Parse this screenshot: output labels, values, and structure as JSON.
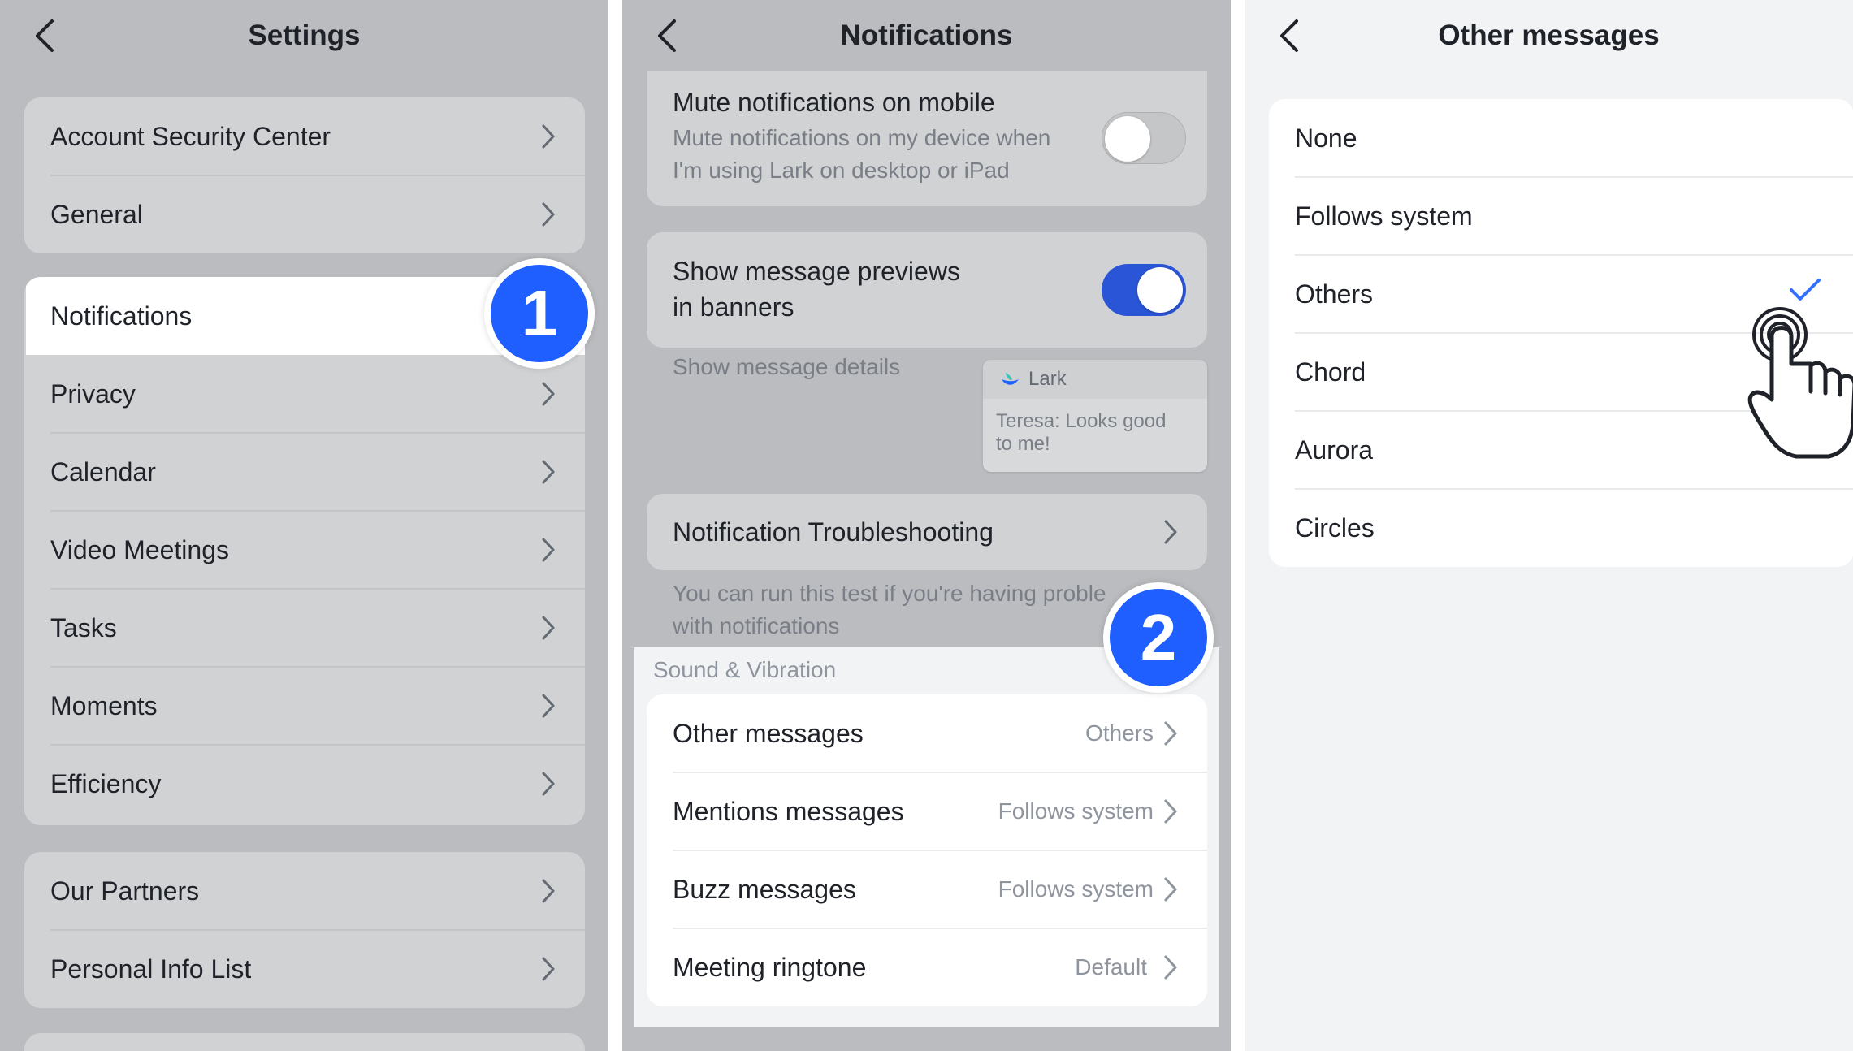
{
  "colors": {
    "accent": "#1f5fff",
    "toggle_on": "#2a55d6",
    "dim_background": "#bbbcbf",
    "light_background": "#f2f3f5"
  },
  "settings": {
    "title": "Settings",
    "groups": [
      [
        "Account Security Center",
        "General"
      ],
      [
        "Notifications",
        "Privacy",
        "Calendar",
        "Video Meetings",
        "Tasks",
        "Moments",
        "Efficiency"
      ],
      [
        "Our Partners",
        "Personal Info List"
      ]
    ],
    "step_badge": "1"
  },
  "notifications": {
    "title": "Notifications",
    "mute": {
      "label": "Mute notifications on mobile",
      "desc_line1": "Mute notifications on my device when",
      "desc_line2": "I'm using Lark on desktop or iPad",
      "enabled": false
    },
    "previews": {
      "label_line1": "Show message previews",
      "label_line2": "in banners",
      "enabled": true
    },
    "details_label": "Show message details",
    "banner_preview": {
      "app": "Lark",
      "message_line1": "Teresa: Looks good",
      "message_line2": "to me!"
    },
    "troubleshooting": {
      "label": "Notification Troubleshooting",
      "note_line1": "You can run this test if you're having proble",
      "note_line2": "with notifications"
    },
    "sound_section": "Sound & Vibration",
    "sound_rows": [
      {
        "label": "Other messages",
        "value": "Others"
      },
      {
        "label": "Mentions messages",
        "value": "Follows system"
      },
      {
        "label": "Buzz messages",
        "value": "Follows system"
      },
      {
        "label": "Meeting ringtone",
        "value": "Default"
      }
    ],
    "step_badge": "2"
  },
  "other_messages": {
    "title": "Other messages",
    "options": [
      "None",
      "Follows system",
      "Others",
      "Chord",
      "Aurora",
      "Circles"
    ],
    "selected": "Others"
  },
  "icons": {
    "back": "chevron-left-icon",
    "row": "chevron-right-icon",
    "check": "checkmark-icon",
    "tap": "tap-hand-icon",
    "app": "lark-logo-icon"
  }
}
